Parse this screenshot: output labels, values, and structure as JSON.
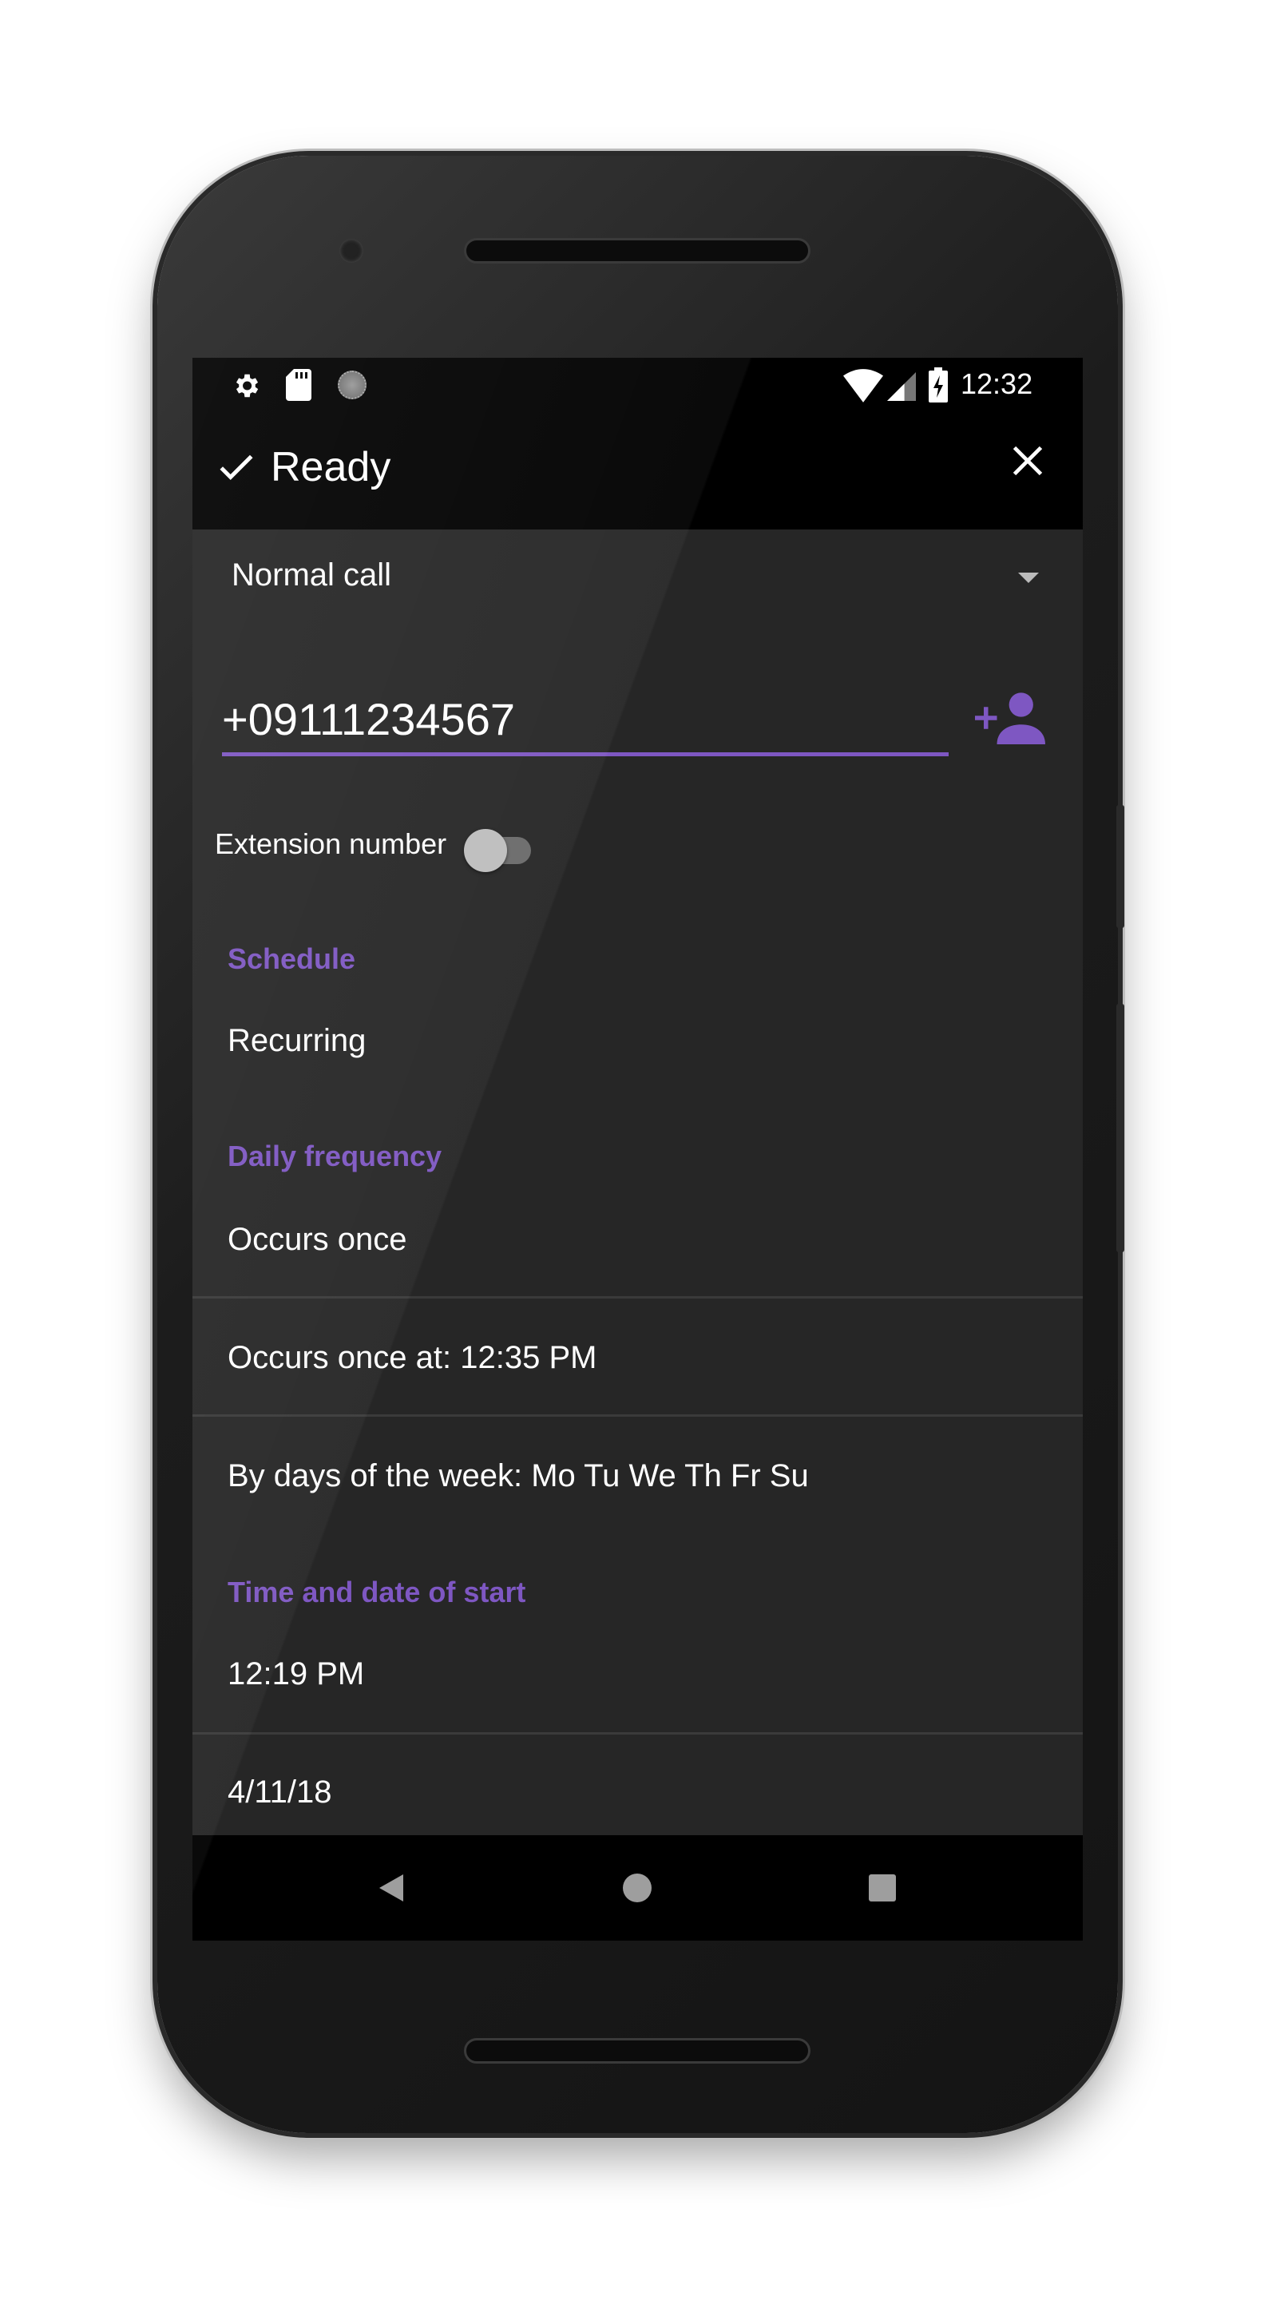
{
  "status_bar": {
    "time": "12:32",
    "left_icons": [
      "gear-icon",
      "sd-card-icon",
      "sync-icon"
    ],
    "right_icons": [
      "wifi-icon",
      "signal-icon",
      "battery-charging-icon"
    ]
  },
  "toolbar": {
    "title": "Ready",
    "confirm_icon": "check-icon",
    "close_icon": "close-icon"
  },
  "call_type": {
    "selected": "Normal call"
  },
  "phone_number": {
    "value": "+09111234567",
    "add_contact_icon": "person-add-icon"
  },
  "extension": {
    "label": "Extension number",
    "enabled": false
  },
  "schedule": {
    "label": "Schedule",
    "value": "Recurring"
  },
  "daily_frequency": {
    "label": "Daily frequency",
    "value": "Occurs once",
    "occurs_at": "Occurs once at: 12:35 PM",
    "days": "By days of the week: Mo Tu We Th Fr Su"
  },
  "start": {
    "label": "Time and date of start",
    "time": "12:19 PM",
    "date": "4/11/18"
  },
  "colors": {
    "accent": "#7e57c2",
    "background": "#262626",
    "bars": "#000000"
  },
  "nav": {
    "back_icon": "back-icon",
    "home_icon": "home-icon",
    "recents_icon": "recents-icon"
  }
}
